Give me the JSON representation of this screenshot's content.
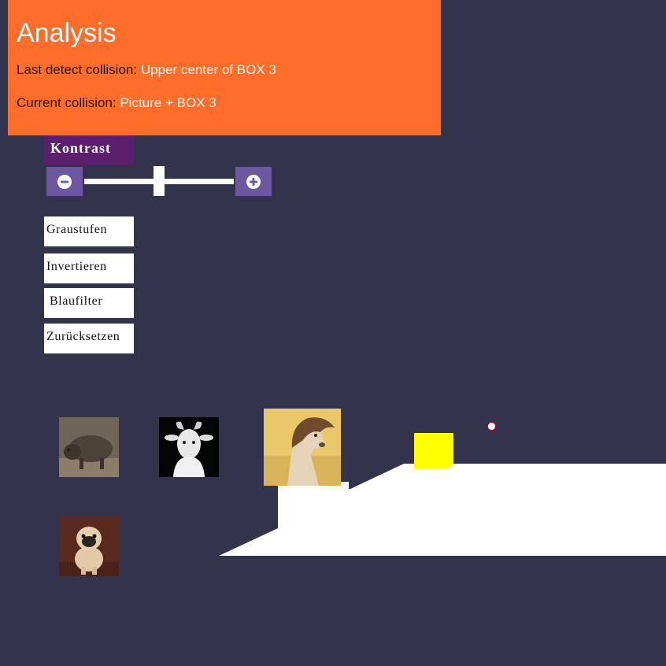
{
  "analysis": {
    "title": "Analysis",
    "last_collision_label": "Last detect collision:",
    "last_collision_value": "Upper center of BOX 3",
    "current_collision_label": "Current collision:",
    "current_collision_value": "Picture + BOX 3"
  },
  "controls": {
    "contrast_label": "Kontrast",
    "contrast_value_fraction": 0.5,
    "decrease_icon": "minus-circle-icon",
    "increase_icon": "plus-circle-icon",
    "buttons": {
      "grayscale": "Graustufen",
      "invert": "Invertieren",
      "bluefilter": "Blaufilter",
      "reset": "Zurücksetzen"
    }
  },
  "pictures": [
    "boar",
    "goat",
    "horse",
    "pug"
  ],
  "colors": {
    "background": "#34334c",
    "panel": "#ff6d2a",
    "contrast_label_bg": "#5b1f6e",
    "stepper_bg": "#6d56a2",
    "box": "#ffff00",
    "dot_border": "#c8102e"
  }
}
